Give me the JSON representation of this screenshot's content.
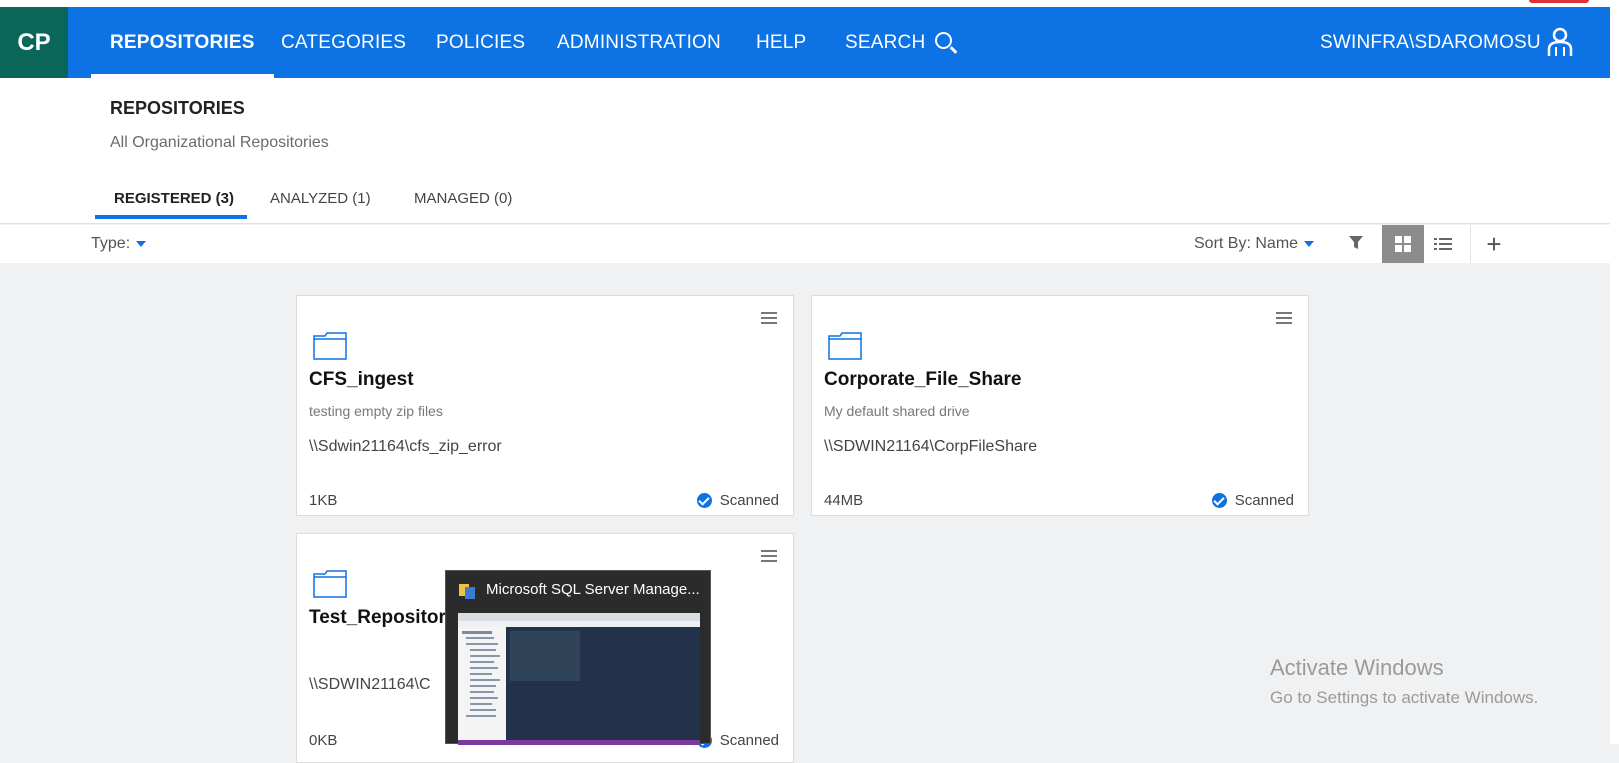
{
  "nav": {
    "logo": "CP",
    "items": [
      "REPOSITORIES",
      "CATEGORIES",
      "POLICIES",
      "ADMINISTRATION",
      "HELP",
      "SEARCH"
    ],
    "user": "SWINFRA\\SDAROMOSU"
  },
  "header": {
    "title": "REPOSITORIES",
    "subtitle": "All Organizational Repositories",
    "tabs": [
      "REGISTERED (3)",
      "ANALYZED (1)",
      "MANAGED (0)"
    ]
  },
  "toolbar": {
    "type_label": "Type:",
    "sort_label": "Sort By:",
    "sort_value": "Name"
  },
  "cards": [
    {
      "name": "CFS_ingest",
      "description": "testing empty zip files",
      "path": "\\\\Sdwin21164\\cfs_zip_error",
      "size": "1KB",
      "status": "Scanned"
    },
    {
      "name": "Corporate_File_Share",
      "description": "My default shared drive",
      "path": "\\\\SDWIN21164\\CorpFileShare",
      "size": "44MB",
      "status": "Scanned"
    },
    {
      "name": "Test_Repositor",
      "description": "",
      "path": "\\\\SDWIN21164\\C",
      "size": "0KB",
      "status": "Scanned"
    }
  ],
  "taskbar_preview": {
    "title": "Microsoft SQL Server Manage..."
  },
  "watermark": {
    "line1": "Activate Windows",
    "line2": "Go to Settings to activate Windows."
  },
  "colors": {
    "nav_blue": "#0d72e3",
    "logo_green": "#0a6659",
    "scanned_check": "#0d72e3"
  }
}
